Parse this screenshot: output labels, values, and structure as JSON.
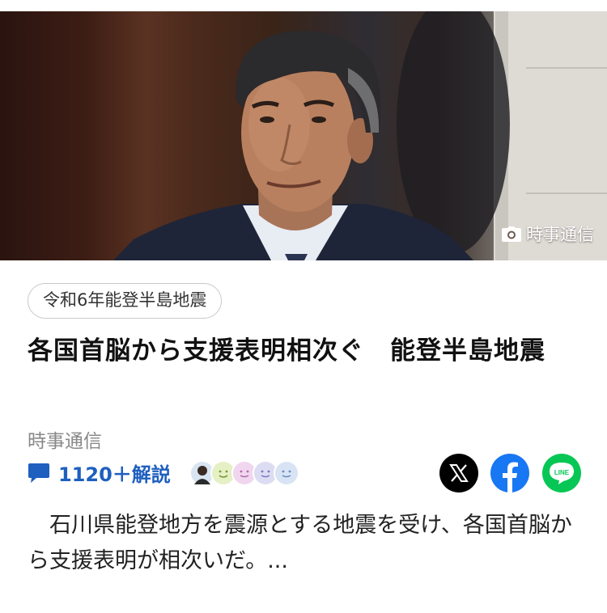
{
  "hero": {
    "credit": "時事通信"
  },
  "tag": {
    "label": "令和6年能登半島地震"
  },
  "article": {
    "title": "各国首脳から支援表明相次ぐ　能登半島地震",
    "source": "時事通信",
    "snippet": "石川県能登地方を震源とする地震を受け、各国首脳から支援表明が相次いだ。..."
  },
  "comments": {
    "count_label": "1120＋解説"
  },
  "share": {
    "x_icon": "x-logo-icon",
    "facebook_icon": "facebook-logo-icon",
    "line_label": "LINE"
  },
  "colors": {
    "link_blue": "#1e5fbf",
    "facebook": "#1877f2",
    "line": "#06c755",
    "x": "#000000"
  }
}
